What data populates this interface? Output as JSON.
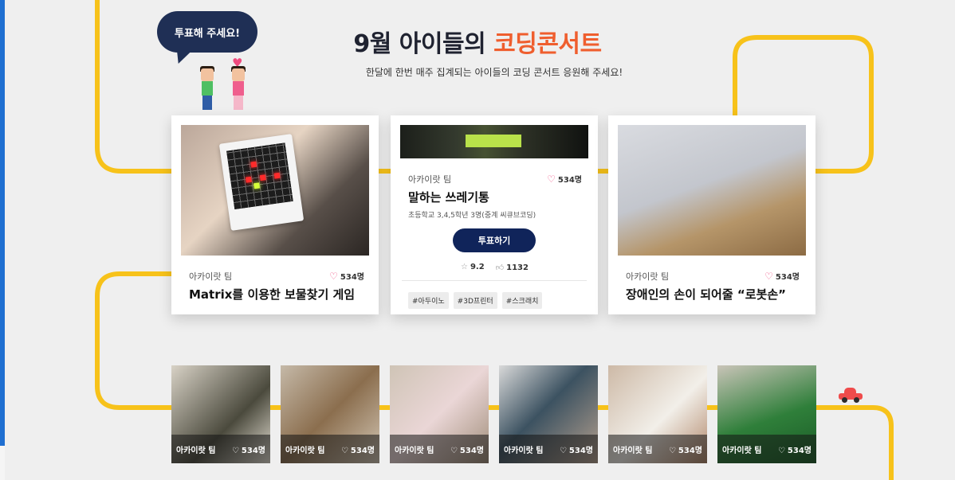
{
  "header": {
    "title_prefix": "9월 아이들의 ",
    "title_accent": "코딩콘서트",
    "subtitle": "한달에 한번 매주 집계되는 아이들의 코딩 콘서트 응원해 주세요!",
    "bubble": "투표해 주세요!"
  },
  "colors": {
    "accent": "#ef5e2e",
    "navy": "#10245a",
    "track": "#f7c21a",
    "heart": "#ef4b7f"
  },
  "featured": [
    {
      "team": "아카이랏 팀",
      "likes": "534명",
      "name": "Matrix를 이용한 보물찾기 게임"
    },
    {
      "team": "아카이랏 팀",
      "likes": "534명",
      "name": "말하는 쓰레기통",
      "school": "초등학교 3,4,5학년 3명(중계 씨큐브코딩)",
      "vote_label": "투표하기",
      "rating": "9.2",
      "thumbs": "1132",
      "tags": [
        "#아두이노",
        "#3D프린터",
        "#스크래치"
      ]
    },
    {
      "team": "아카이랏 팀",
      "likes": "534명",
      "name": "장애인의 손이 되어줄 “로봇손”"
    }
  ],
  "thumbs": [
    {
      "team": "아카이랏 팀",
      "likes": "534명"
    },
    {
      "team": "아카이랏 팀",
      "likes": "534명"
    },
    {
      "team": "아카이랏 팀",
      "likes": "534명"
    },
    {
      "team": "아카이랏 팀",
      "likes": "534명"
    },
    {
      "team": "아카이랏 팀",
      "likes": "534명"
    },
    {
      "team": "아카이랏 팀",
      "likes": "534명"
    }
  ]
}
